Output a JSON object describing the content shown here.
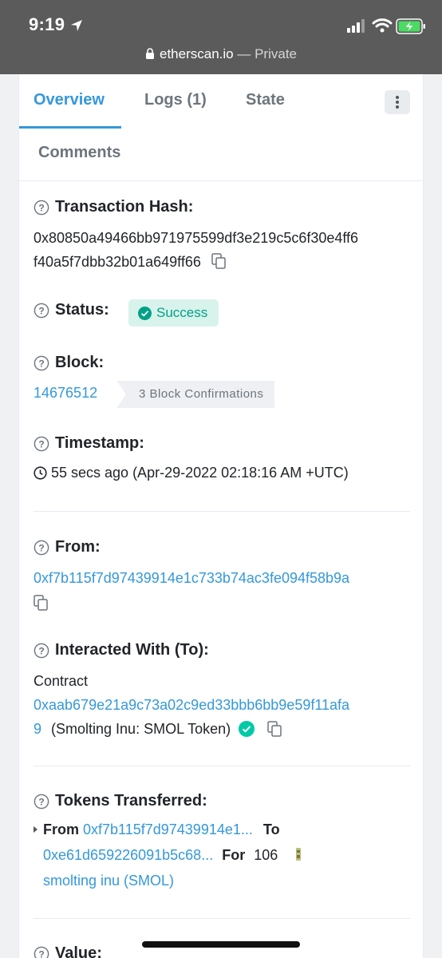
{
  "status_bar": {
    "time": "9:19",
    "domain": "etherscan.io",
    "privacy": "— Private"
  },
  "tabs": [
    {
      "label": "Overview",
      "active": true
    },
    {
      "label": "Logs (1)",
      "active": false
    },
    {
      "label": "State",
      "active": false
    },
    {
      "label": "Comments",
      "active": false
    }
  ],
  "tx_hash": {
    "label": "Transaction Hash:",
    "line1": "0x80850a49466bb971975599df3e219c5c6f30e4ff6",
    "line2": "f40a5f7dbb32b01a649ff66"
  },
  "status": {
    "label": "Status:",
    "value": "Success"
  },
  "block": {
    "label": "Block:",
    "number": "14676512",
    "confirmations": "3 Block Confirmations"
  },
  "timestamp": {
    "label": "Timestamp:",
    "value": "55 secs ago (Apr-29-2022 02:18:16 AM +UTC)"
  },
  "from": {
    "label": "From:",
    "address": "0xf7b115f7d97439914e1c733b74ac3fe094f58b9a"
  },
  "interacted_with": {
    "label": "Interacted With (To):",
    "contract_label": "Contract",
    "address_line1": "0xaab679e21a9c73a02c9ed33bbb6bb9e59f11afa",
    "address_line2": "9",
    "name": "(Smolting Inu: SMOL Token)"
  },
  "tokens_transferred": {
    "label": "Tokens Transferred:",
    "from_label": "From",
    "from_address": "0xf7b115f7d97439914e1...",
    "to_label": "To",
    "to_address": "0xe61d659226091b5c68...",
    "for_label": "For",
    "amount": "106",
    "token_name": "smolting inu (SMOL)"
  },
  "value": {
    "label": "Value:"
  },
  "colors": {
    "accent": "#3498db",
    "success": "#00a186",
    "success_bg": "#d8f3ec"
  }
}
